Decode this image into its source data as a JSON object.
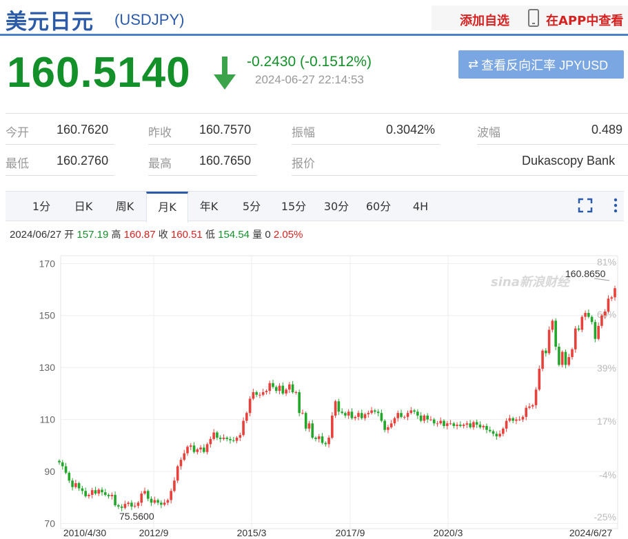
{
  "header": {
    "title": "美元日元",
    "subtitle": "(USDJPY)",
    "add_watchlist": "添加自选",
    "app_view": "在APP中查看"
  },
  "quote": {
    "price": "160.5140",
    "change": "-0.2430 (-0.1512%)",
    "timestamp": "2024-06-27 22:14:53",
    "reverse_button": "查看反向汇率 JPYUSD",
    "direction": "down",
    "up_color": "#d72121",
    "down_color": "#13902a"
  },
  "stats": {
    "open_label": "今开",
    "open": "160.7620",
    "prev_close_label": "昨收",
    "prev_close": "160.7570",
    "amplitude_label": "振幅",
    "amplitude": "0.3042%",
    "volatility_label": "波幅",
    "volatility": "0.489",
    "low_label": "最低",
    "low": "160.2760",
    "high_label": "最高",
    "high": "160.7650",
    "quote_label": "报价",
    "quote_source": "Dukascopy Bank"
  },
  "tabs": [
    "1分",
    "日K",
    "周K",
    "月K",
    "年K",
    "5分",
    "15分",
    "30分",
    "60分",
    "4H"
  ],
  "active_tab": "月K",
  "ohlc": {
    "date": "2024/06/27",
    "open_label": "开",
    "open": "157.19",
    "high_label": "高",
    "high": "160.87",
    "close_label": "收",
    "close": "160.51",
    "low_label": "低",
    "low": "154.54",
    "volume_label": "量",
    "volume": "0",
    "change_pct": "2.05%"
  },
  "chart_data": {
    "type": "candlestick",
    "y_ticks": [
      70,
      90,
      110,
      130,
      150,
      170
    ],
    "ylim": [
      68,
      173
    ],
    "pct_ticks": [
      "81%",
      "60%",
      "39%",
      "17%",
      "-4%",
      "-25%"
    ],
    "x_ticks": [
      "2010/4/30",
      "2012/9",
      "2015/3",
      "2017/9",
      "2020/3",
      "2024/6/27"
    ],
    "max_label": "160.8650",
    "min_label": "75.5600",
    "watermark": "sina新浪财经",
    "closes": [
      93.5,
      92.0,
      89.5,
      86.5,
      84.0,
      85.5,
      83.5,
      82.5,
      80.5,
      81.0,
      82.8,
      81.5,
      83.0,
      82.0,
      81.0,
      80.5,
      81.0,
      77.0,
      76.5,
      76.0,
      77.5,
      78.0,
      76.5,
      76.8,
      78.0,
      81.5,
      82.5,
      79.5,
      78.0,
      79.0,
      78.0,
      77.2,
      78.0,
      79.0,
      82.5,
      86.5,
      92.0,
      94.5,
      97.0,
      99.5,
      100.0,
      97.5,
      98.5,
      99.2,
      97.5,
      100.5,
      102.5,
      105.0,
      103.0,
      102.5,
      103.0,
      102.5,
      102.0,
      101.8,
      103.0,
      104.0,
      109.5,
      112.5,
      118.0,
      120.5,
      119.5,
      119.5,
      120.5,
      121.0,
      124.0,
      122.5,
      121.0,
      123.0,
      120.0,
      121.5,
      123.5,
      120.5,
      120.5,
      112.5,
      112.5,
      106.5,
      108.5,
      103.0,
      102.5,
      103.5,
      101.0,
      100.5,
      103.0,
      111.5,
      117.0,
      113.0,
      112.5,
      111.5,
      113.0,
      110.5,
      111.0,
      112.5,
      110.5,
      112.0,
      112.5,
      113.5,
      113.0,
      112.5,
      109.5,
      106.0,
      107.0,
      108.5,
      110.5,
      112.5,
      111.0,
      111.0,
      112.5,
      113.5,
      113.0,
      111.5,
      109.5,
      111.5,
      110.0,
      110.0,
      108.5,
      108.5,
      109.5,
      107.5,
      108.5,
      108.5,
      107.5,
      108.0,
      107.5,
      108.0,
      108.5,
      107.0,
      109.0,
      108.0,
      107.0,
      107.5,
      106.0,
      105.5,
      104.5,
      103.5,
      104.5,
      106.5,
      109.5,
      110.5,
      109.5,
      110.0,
      110.0,
      111.0,
      114.5,
      115.0,
      115.5,
      121.5,
      129.5,
      136.5,
      135.5,
      144.5,
      148.0,
      138.0,
      131.0,
      136.0,
      131.0,
      134.0,
      137.0,
      145.0,
      144.5,
      149.5,
      151.0,
      149.5,
      147.5,
      141.0,
      146.0,
      150.0,
      151.5,
      156.5,
      157.0,
      160.5
    ]
  }
}
